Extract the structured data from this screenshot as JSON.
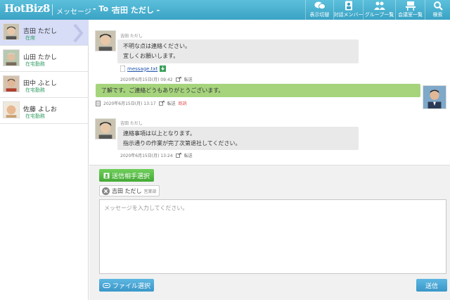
{
  "header": {
    "logo": "HotBiz8",
    "app_name": "メッセージ",
    "to_label": "- To :",
    "to_name": "吉田 ただし -",
    "nav": [
      {
        "label": "表示切替",
        "icon": "chat-bubbles-icon"
      },
      {
        "label": "対話メンバー",
        "icon": "member-icon"
      },
      {
        "label": "グループ一覧",
        "icon": "group-icon"
      },
      {
        "label": "会議室一覧",
        "icon": "meeting-room-icon"
      },
      {
        "label": "検索",
        "icon": "search-icon"
      }
    ]
  },
  "contacts": [
    {
      "name": "吉田 ただし",
      "status": "在席"
    },
    {
      "name": "山田 たかし",
      "status": "在宅勤務"
    },
    {
      "name": "田中 ふとし",
      "status": "在宅勤務"
    },
    {
      "name": "佐藤 よしお",
      "status": "在宅勤務"
    }
  ],
  "messages": [
    {
      "sender": "吉田 ただし",
      "lines": [
        "不明な点は連絡ください。",
        "宜しくお願いします。"
      ],
      "attachment": "message.txt",
      "time": "2020年6月15日(月) 09:42",
      "forward": "転送"
    },
    {
      "sender": "",
      "lines": [
        "了解です。ご連絡どうもありがとうございます。"
      ],
      "time": "2020年6月15日(月) 13:17",
      "forward": "転送",
      "status": "既読"
    },
    {
      "sender": "吉田 ただし",
      "lines": [
        "連絡事項は以上となります。",
        "指示通りの作業が完了次第退社してください。"
      ],
      "time": "2020年6月15日(月) 13:24",
      "forward": "転送"
    }
  ],
  "compose": {
    "select_recipient": "送信相手選択",
    "recipient_chip": "吉田 ただし",
    "recipient_chip_sub": "営業部",
    "placeholder": "メッセージを入力してください。",
    "file_button": "ファイル選択",
    "send_button": "送信"
  },
  "colors": {
    "header": "#3aa2c4",
    "active_contact": "#d7dcf7",
    "my_bubble": "#a6d47d",
    "green_button": "#43a935",
    "blue_button": "#3a97c8"
  }
}
